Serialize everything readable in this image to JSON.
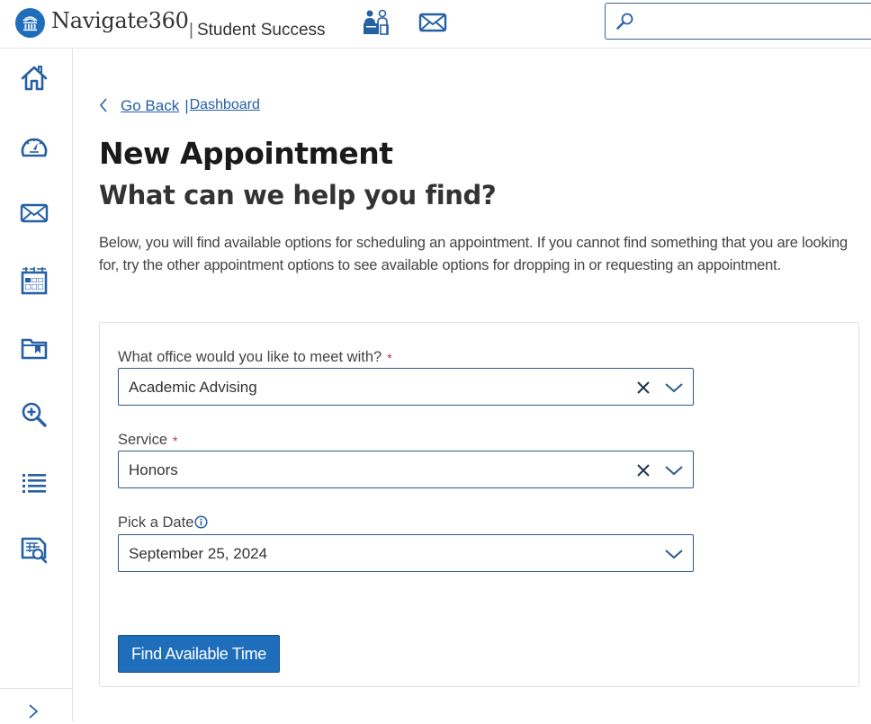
{
  "header": {
    "brand_name": "Navigate360",
    "brand_sub_separator": "|",
    "brand_sub": "Student Success",
    "icons": [
      {
        "name": "staff-desk-icon",
        "label": "Staff"
      },
      {
        "name": "mail-icon",
        "label": "Messages"
      }
    ],
    "search": {
      "placeholder": "",
      "value": ""
    }
  },
  "sidebar": {
    "items": [
      {
        "name": "home",
        "icon": "home-icon"
      },
      {
        "name": "dashboard",
        "icon": "gauge-icon"
      },
      {
        "name": "messages",
        "icon": "envelope-icon"
      },
      {
        "name": "calendar",
        "icon": "calendar-icon"
      },
      {
        "name": "documents",
        "icon": "folder-bookmark-icon"
      },
      {
        "name": "search",
        "icon": "zoom-in-icon"
      },
      {
        "name": "lists",
        "icon": "list-icon"
      },
      {
        "name": "reports",
        "icon": "report-search-icon"
      }
    ],
    "expand_icon": "chevron-right-icon"
  },
  "breadcrumb": {
    "back_label": "Go Back",
    "separator": "|",
    "dashboard_label": "Dashboard"
  },
  "page": {
    "title": "New Appointment",
    "subtitle": "What can we help you find?",
    "intro": "Below, you will find available options for scheduling an appointment. If you cannot find something that you are looking for, try the other appointment options to see available options for dropping in or requesting an appointment."
  },
  "form": {
    "office": {
      "label": "What office would you like to meet with?",
      "required_mark": "*",
      "value": "Academic Advising"
    },
    "service": {
      "label": "Service",
      "required_mark": "*",
      "value": "Honors"
    },
    "date": {
      "label": "Pick a Date",
      "value": "September 25, 2024"
    },
    "submit_label": "Find Available Time"
  },
  "colors": {
    "brand": "#1f6ebc",
    "link": "#2660a4",
    "required": "#b2334f",
    "border": "#2f5a8a"
  }
}
